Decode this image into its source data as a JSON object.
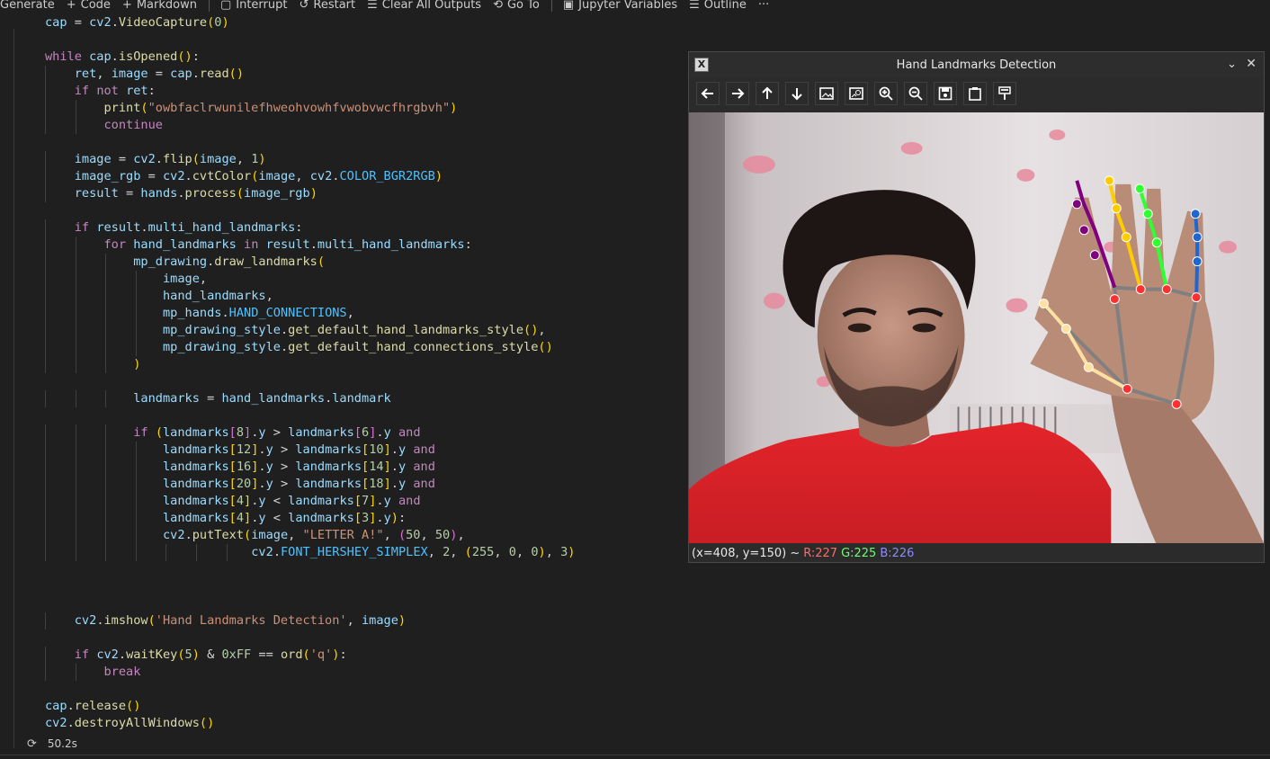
{
  "toolbar": {
    "items": [
      {
        "icon": "none",
        "label": "Generate"
      },
      {
        "icon": "plus-icon",
        "label": "Code"
      },
      {
        "icon": "plus-icon",
        "label": "Markdown"
      },
      {
        "icon": "stop-icon",
        "label": "Interrupt"
      },
      {
        "icon": "restart-icon",
        "label": "Restart"
      },
      {
        "icon": "clear-outputs-icon",
        "label": "Clear All Outputs"
      },
      {
        "icon": "goto-icon",
        "label": "Go To"
      },
      {
        "icon": "variables-icon",
        "label": "Jupyter Variables"
      },
      {
        "icon": "outline-icon",
        "label": "Outline"
      },
      {
        "icon": "more-icon",
        "label": "···"
      }
    ]
  },
  "code": {
    "lines": [
      "cap = cv2.VideoCapture(0)",
      "",
      "while cap.isOpened():",
      "    ret, image = cap.read()",
      "    if not ret:",
      "        print(\"owbfaclrwunilefhweohvowhfvwobvwcfhrgbvh\")",
      "        continue",
      "",
      "    image = cv2.flip(image, 1)",
      "    image_rgb = cv2.cvtColor(image, cv2.COLOR_BGR2RGB)",
      "    result = hands.process(image_rgb)",
      "",
      "    if result.multi_hand_landmarks:",
      "        for hand_landmarks in result.multi_hand_landmarks:",
      "            mp_drawing.draw_landmarks(",
      "                image,",
      "                hand_landmarks,",
      "                mp_hands.HAND_CONNECTIONS,",
      "                mp_drawing_style.get_default_hand_landmarks_style(),",
      "                mp_drawing_style.get_default_hand_connections_style()",
      "            )",
      "",
      "            landmarks = hand_landmarks.landmark",
      "",
      "            if (landmarks[8].y > landmarks[6].y and",
      "                landmarks[12].y > landmarks[10].y and",
      "                landmarks[16].y > landmarks[14].y and",
      "                landmarks[20].y > landmarks[18].y and",
      "                landmarks[4].y < landmarks[7].y and",
      "                landmarks[4].y < landmarks[3].y):",
      "                cv2.putText(image, \"LETTER A!\", (50, 50),",
      "                            cv2.FONT_HERSHEY_SIMPLEX, 2, (255, 0, 0), 3)",
      "",
      "",
      "",
      "    cv2.imshow('Hand Landmarks Detection', image)",
      "",
      "    if cv2.waitKey(5) & 0xFF == ord('q'):",
      "        break",
      "",
      "cap.release()",
      "cv2.destroyAllWindows()"
    ]
  },
  "status": {
    "time": "50.2s",
    "icon": "sync-icon"
  },
  "cv_window": {
    "title": "Hand Landmarks Detection",
    "tools": [
      "arrow-left-icon",
      "arrow-right-icon",
      "arrow-up-icon",
      "arrow-down-icon",
      "image-icon",
      "image-settings-icon",
      "zoom-in-icon",
      "zoom-out-icon",
      "save-icon",
      "copy-clipboard-icon",
      "properties-icon"
    ],
    "status_prefix": "(x=408, y=150) ~",
    "r": "R:227",
    "g": "G:225",
    "b": "B:226"
  }
}
